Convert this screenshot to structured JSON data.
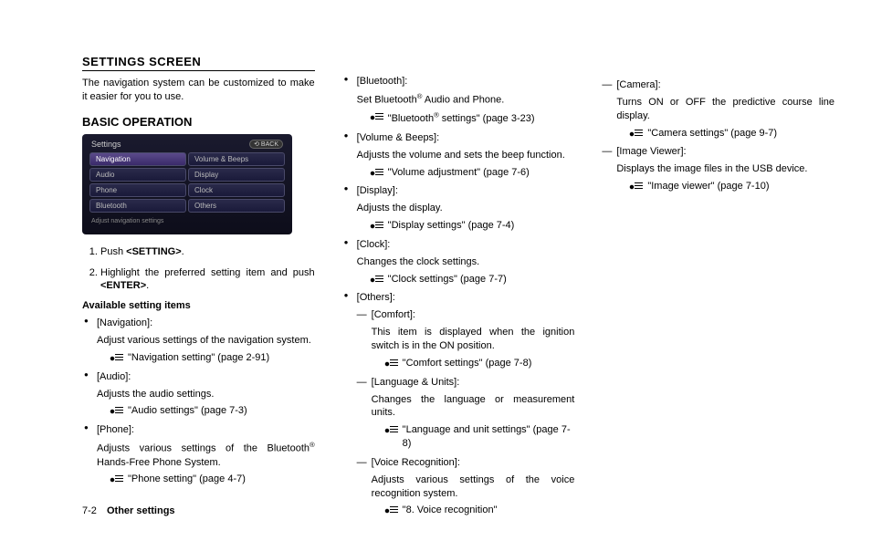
{
  "heading": "SETTINGS SCREEN",
  "intro": "The navigation system can be customized to make it easier for you to use.",
  "basic_op": "BASIC OPERATION",
  "screenshot": {
    "title": "Settings",
    "back": "⟲ BACK",
    "items": [
      "Navigation",
      "Volume & Beeps",
      "Audio",
      "Display",
      "Phone",
      "Clock",
      "Bluetooth",
      "Others"
    ],
    "footer": "Adjust navigation settings"
  },
  "steps": [
    {
      "pre": "Push ",
      "bold": "<SETTING>",
      "post": "."
    },
    {
      "pre": "Highlight the preferred setting item and push ",
      "bold": "<ENTER>",
      "post": "."
    }
  ],
  "avail_head": "Available setting items",
  "col1_items": [
    {
      "label": "[Navigation]:",
      "desc": "Adjust various settings of the navigation system.",
      "ref": "\"Navigation setting\" (page 2-91)"
    },
    {
      "label": "[Audio]:",
      "desc": "Adjusts the audio settings.",
      "ref": "\"Audio settings\" (page 7-3)"
    },
    {
      "label": "[Phone]:",
      "desc_html": "Adjusts various settings of the Bluetooth<sup>®</sup> Hands-Free Phone System.",
      "ref": "\"Phone setting\" (page 4-7)"
    }
  ],
  "col2_items": [
    {
      "label": "[Bluetooth]:",
      "desc_html": "Set Bluetooth<sup>®</sup> Audio and Phone.",
      "ref_html": "\"Bluetooth<sup>®</sup> settings\" (page 3-23)"
    },
    {
      "label": "[Volume & Beeps]:",
      "desc": "Adjusts the volume and sets the beep function.",
      "ref": "\"Volume adjustment\" (page 7-6)"
    },
    {
      "label": "[Display]:",
      "desc": "Adjusts the display.",
      "ref": "\"Display settings\" (page 7-4)"
    },
    {
      "label": "[Clock]:",
      "desc": "Changes the clock settings.",
      "ref": "\"Clock settings\" (page 7-7)"
    },
    {
      "label": "[Others]:",
      "sub": [
        {
          "label": "[Comfort]:",
          "desc": "This item is displayed when the ignition switch is in the ON position.",
          "ref": "\"Comfort settings\" (page 7-8)"
        },
        {
          "label": "[Language & Units]:",
          "desc": "Changes the language or measurement units.",
          "ref": "\"Language and unit settings\" (page 7-8)"
        },
        {
          "label": "[Voice Recognition]:",
          "desc": "Adjusts various settings of the voice recognition system.",
          "ref": "\"8. Voice recognition\""
        }
      ]
    }
  ],
  "col3_items": [
    {
      "label": "[Camera]:",
      "desc": "Turns ON or OFF the predictive course line display.",
      "ref": "\"Camera settings\" (page 9-7)"
    },
    {
      "label": "[Image Viewer]:",
      "desc": "Displays the image files in the USB device.",
      "ref": "\"Image viewer\" (page 7-10)"
    }
  ],
  "footer": {
    "page": "7-2",
    "section": "Other settings"
  }
}
